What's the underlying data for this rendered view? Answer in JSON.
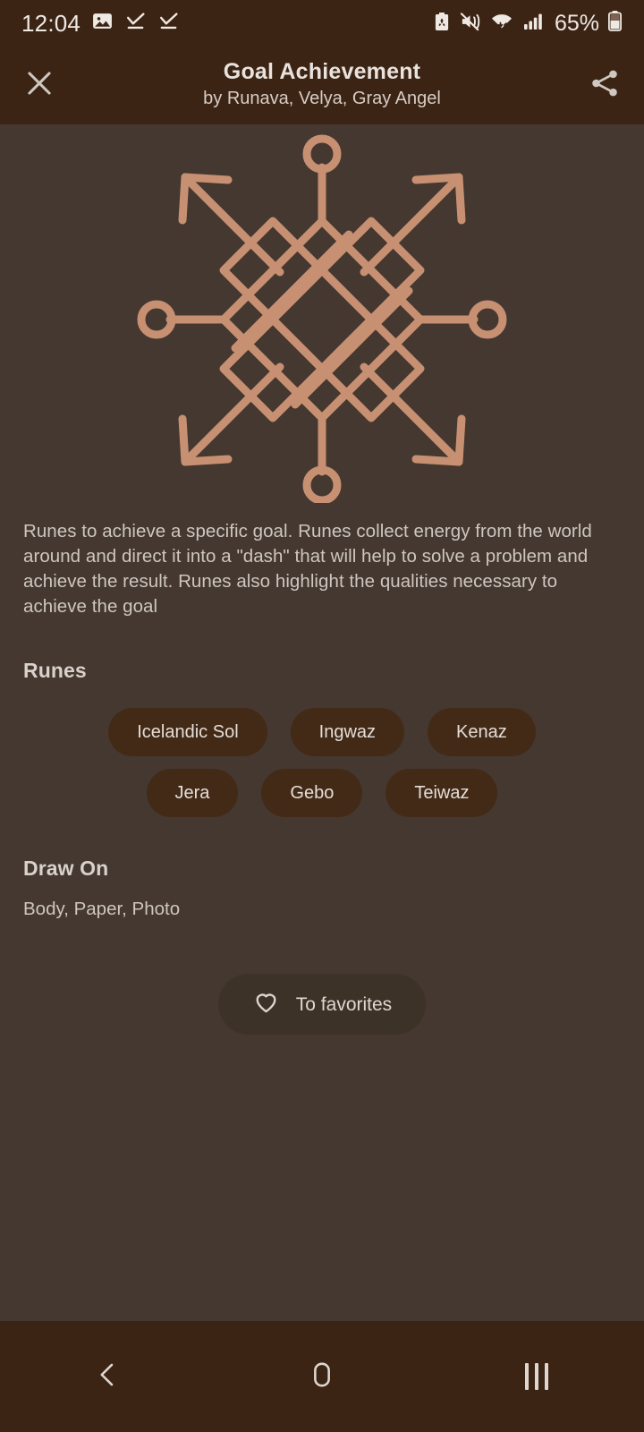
{
  "status_bar": {
    "clock": "12:04",
    "battery_percent": "65%",
    "icons": [
      "image-icon",
      "download-complete-icon",
      "download-complete-icon",
      "power-saving-icon",
      "mute-vibrate-icon",
      "wifi-icon",
      "cellular-signal-icon",
      "battery-icon"
    ]
  },
  "header": {
    "close_label": "close-icon",
    "title": "Goal Achievement",
    "subtitle": "by Runava, Velya, Gray Angel",
    "share_label": "share-icon"
  },
  "symbol": {
    "name": "goal-achievement-rune-stave",
    "stroke_color": "#c89072",
    "background_color": "#443830"
  },
  "main": {
    "description": "Runes to achieve a specific goal. Runes collect energy from the world around and direct it into a \"dash\" that will help to solve a problem and achieve the result. Runes also highlight the qualities necessary to achieve the goal",
    "runes_heading": "Runes",
    "runes": [
      {
        "label": "Icelandic Sol"
      },
      {
        "label": "Ingwaz"
      },
      {
        "label": "Kenaz"
      },
      {
        "label": "Jera"
      },
      {
        "label": "Gebo"
      },
      {
        "label": "Teiwaz"
      }
    ],
    "draw_on_heading": "Draw On",
    "draw_on_value": "Body, Paper, Photo",
    "favorites_button": "To favorites"
  },
  "nav_bar": {
    "back": "back-icon",
    "home": "home-icon",
    "recents": "recents-icon"
  },
  "colors": {
    "chrome": "#3b2414",
    "surface": "#443830",
    "chip": "#432a17",
    "accent": "#c89072",
    "text_primary": "#e9e2dd",
    "text_secondary": "#cec6c0"
  }
}
